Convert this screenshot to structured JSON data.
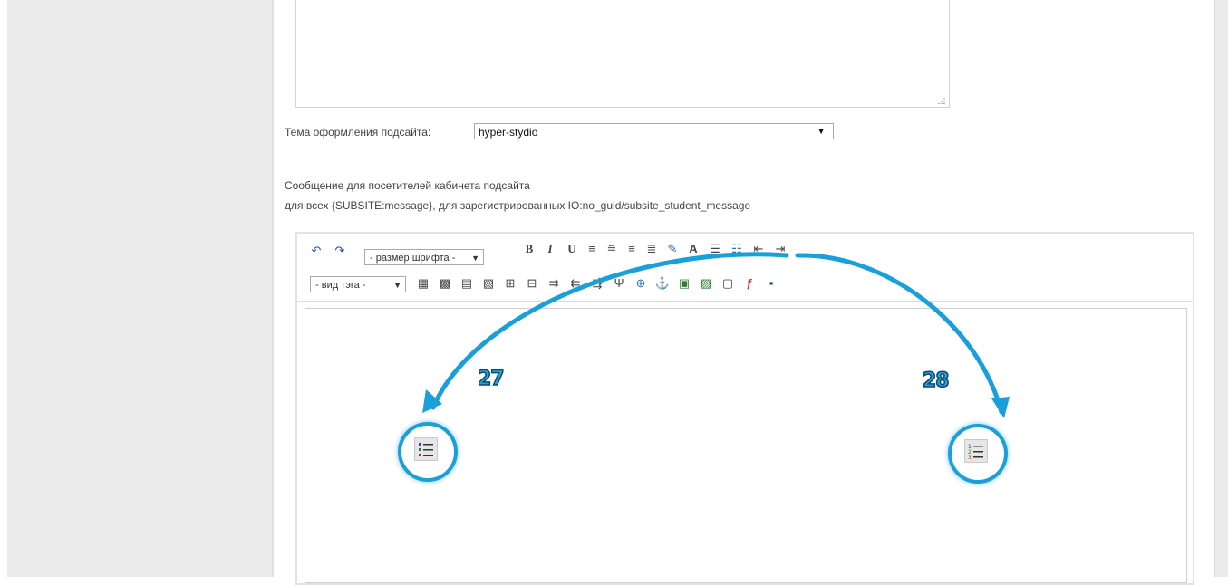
{
  "theme": {
    "label": "Тема оформления подсайта:",
    "selected": "hyper-stydio"
  },
  "message": {
    "line1": "Сообщение для посетителей кабинета подсайта",
    "line2": "для всех {SUBSITE:message}, для зарегистрированных IO:no_guid/subsite_student_message"
  },
  "editor": {
    "font_size_select": "- размер шрифта -",
    "tag_select": "- вид тэга -",
    "row1_icons": [
      "undo-icon",
      "redo-icon",
      "bold-icon",
      "italic-icon",
      "underline-icon",
      "align-left-icon",
      "align-center-icon",
      "align-right-icon",
      "align-justify-icon",
      "highlight-color-icon",
      "text-color-icon",
      "bullet-list-icon",
      "numbered-list-icon",
      "outdent-icon",
      "indent-icon"
    ],
    "row2_icons": [
      "table-icon",
      "edit-table-icon",
      "table-props-icon",
      "cell-props-icon",
      "insert-row-icon",
      "delete-row-icon",
      "insert-col-icon",
      "delete-col-icon",
      "split-cell-icon",
      "merge-cell-icon",
      "link-icon",
      "anchor-icon",
      "image-icon",
      "image-props-icon",
      "file-icon",
      "flash-icon",
      "save-icon"
    ]
  },
  "callouts": [
    {
      "number": "27",
      "icon": "bullet-list-icon"
    },
    {
      "number": "28",
      "icon": "numbered-list-icon"
    }
  ],
  "colors": {
    "accent": "#1a9fd8",
    "callout_text": "#2a9fd6"
  }
}
